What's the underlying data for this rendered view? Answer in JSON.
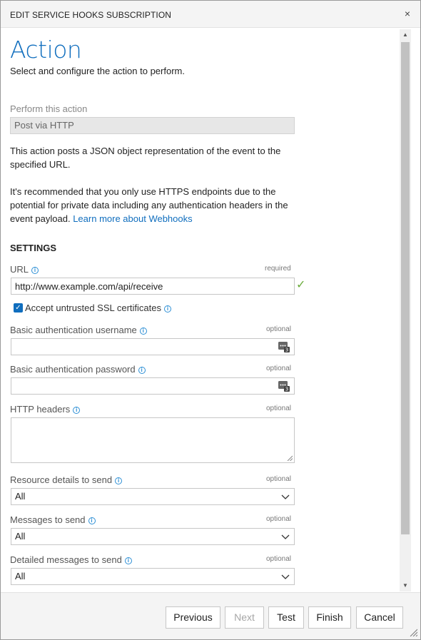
{
  "dialog": {
    "title": "EDIT SERVICE HOOKS SUBSCRIPTION",
    "close_glyph": "×"
  },
  "header": {
    "title": "Action",
    "subtitle": "Select and configure the action to perform."
  },
  "action": {
    "label": "Perform this action",
    "value": "Post via HTTP",
    "description": "This action posts a JSON object representation of the event to the specified URL.",
    "recommendation": "It's recommended that you only use HTTPS endpoints due to the potential for private data including any authentication headers in the event payload.",
    "learn_more": "Learn more about Webhooks"
  },
  "settings": {
    "heading": "SETTINGS",
    "url": {
      "label": "URL",
      "tag": "required",
      "value": "http://www.example.com/api/receive"
    },
    "accept_ssl": {
      "label": "Accept untrusted SSL certificates",
      "checked": true
    },
    "username": {
      "label": "Basic authentication username",
      "tag": "optional",
      "value": ""
    },
    "password": {
      "label": "Basic authentication password",
      "tag": "optional",
      "value": ""
    },
    "headers": {
      "label": "HTTP headers",
      "tag": "optional",
      "value": ""
    },
    "resource_details": {
      "label": "Resource details to send",
      "tag": "optional",
      "value": "All"
    },
    "messages": {
      "label": "Messages to send",
      "tag": "optional",
      "value": "All"
    },
    "detailed_messages": {
      "label": "Detailed messages to send",
      "tag": "optional",
      "value": "All"
    }
  },
  "footer": {
    "previous": "Previous",
    "next": "Next",
    "test": "Test",
    "finish": "Finish",
    "cancel": "Cancel"
  },
  "colors": {
    "accent": "#106ebe",
    "valid": "#6aab3a",
    "info": "#2d8fd5"
  },
  "icons": {
    "close": "close-icon",
    "info": "info-icon",
    "valid": "checkmark-icon",
    "password_manager": "keyboard-icon",
    "dropdown": "chevron-down-icon",
    "resize": "resize-grip-icon"
  }
}
